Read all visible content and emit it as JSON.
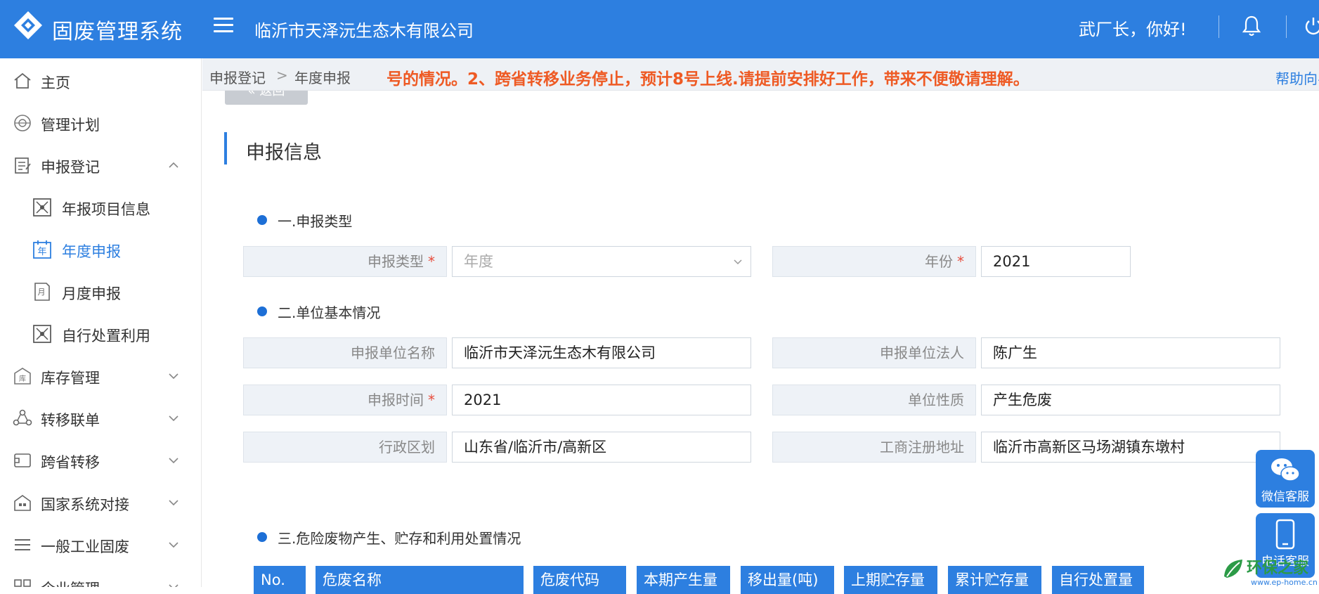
{
  "header": {
    "app_title": "固废管理系统",
    "company": "临沂市天泽沅生态木有限公司",
    "greeting": "武厂长，你好!",
    "icons": [
      "logo-icon",
      "menu-icon",
      "bell-icon",
      "power-icon"
    ]
  },
  "sidebar": {
    "items": [
      {
        "label": "主页",
        "icon": "home-icon"
      },
      {
        "label": "管理计划",
        "icon": "plan-icon"
      },
      {
        "label": "申报登记",
        "icon": "report-icon",
        "expanded": true
      },
      {
        "label": "年报项目信息",
        "icon": "project-icon"
      },
      {
        "label": "年度申报",
        "icon": "calendar-year-icon",
        "active": true
      },
      {
        "label": "月度申报",
        "icon": "calendar-month-icon"
      },
      {
        "label": "自行处置利用",
        "icon": "dispose-icon"
      },
      {
        "label": "库存管理",
        "icon": "warehouse-icon"
      },
      {
        "label": "转移联单",
        "icon": "transfer-icon"
      },
      {
        "label": "跨省转移",
        "icon": "cross-province-icon"
      },
      {
        "label": "国家系统对接",
        "icon": "national-system-icon"
      },
      {
        "label": "一般工业固废",
        "icon": "list-icon"
      },
      {
        "label": "企业管理",
        "icon": "enterprise-icon"
      }
    ]
  },
  "breadcrumb": {
    "items": [
      "申报登记",
      "年度申报"
    ],
    "notice": "号的情况。2、跨省转移业务停止，预计8号上线.请提前安排好工作，带来不便敬请理解。",
    "help": "帮助向导"
  },
  "main": {
    "back_button": "返回",
    "section_title": "申报信息",
    "groups": [
      {
        "title": "一.申报类型"
      },
      {
        "title": "二.单位基本情况"
      },
      {
        "title": "三.危险废物产生、贮存和利用处置情况"
      }
    ],
    "fields": {
      "report_type": {
        "label": "申报类型",
        "required": "*",
        "value": "年度"
      },
      "year": {
        "label": "年份",
        "required": "*",
        "value": "2021"
      },
      "unit_name": {
        "label": "申报单位名称",
        "value": "临沂市天泽沅生态木有限公司"
      },
      "legal_person": {
        "label": "申报单位法人",
        "value": "陈广生"
      },
      "report_time": {
        "label": "申报时间",
        "required": "*",
        "value": "2021"
      },
      "unit_nature": {
        "label": "单位性质",
        "value": "产生危废"
      },
      "region": {
        "label": "行政区划",
        "value": "山东省/临沂市/高新区"
      },
      "address": {
        "label": "工商注册地址",
        "value": "临沂市高新区马场湖镇东墩村"
      }
    },
    "table_headers": [
      "No.",
      "危废名称",
      "危废代码",
      "本期产生量",
      "移出量(吨)",
      "上期贮存量",
      "累计贮存量",
      "自行处置量"
    ]
  },
  "float": {
    "wechat": "微信客服",
    "phone": "电话客服"
  },
  "watermark": {
    "text": "环保之家",
    "url": "www.ep-home.cn"
  },
  "colors": {
    "primary": "#2d7fe0",
    "notice": "#ee5a24",
    "required": "#e74c3c",
    "label_bg": "#eef2f7"
  }
}
